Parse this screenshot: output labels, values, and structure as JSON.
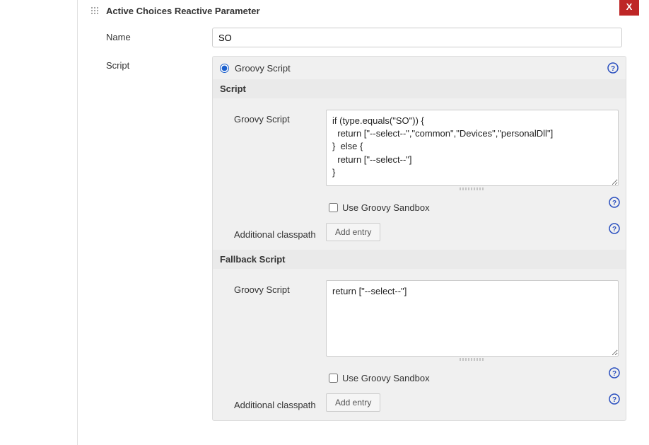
{
  "close_label": "X",
  "section_title": "Active Choices Reactive Parameter",
  "name_label": "Name",
  "name_value": "SO",
  "script_label": "Script",
  "groovy_radio_label": "Groovy Script",
  "script_subheader": "Script",
  "groovy_script_label": "Groovy Script",
  "groovy_script_value": "if (type.equals(\"SO\")) {\n  return [\"--select--\",\"common\",\"Devices\",\"personalDll\"]\n}  else {\n  return [\"--select--\"]\n}",
  "sandbox_label": "Use Groovy Sandbox",
  "additional_classpath_label": "Additional classpath",
  "add_entry_label": "Add entry",
  "fallback_header": "Fallback Script",
  "fallback_script_value": "return [\"--select--\"]"
}
